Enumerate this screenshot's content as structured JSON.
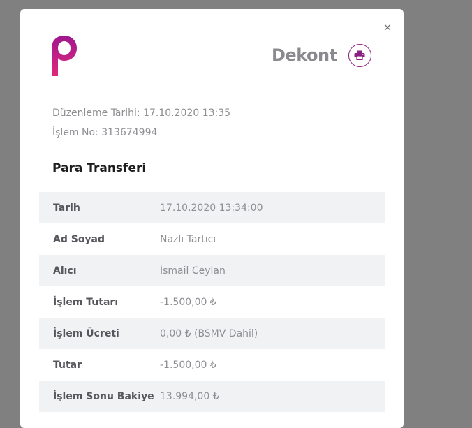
{
  "modal": {
    "title": "Dekont",
    "close_label": "×",
    "icons": {
      "print": "print-icon",
      "logo": "papara-logo",
      "close": "close-icon"
    },
    "accent_color": "#8c1f82"
  },
  "meta": {
    "date_line": "Düzenleme Tarihi: 17.10.2020 13:35",
    "transaction_line": "İşlem No: 313674994"
  },
  "section": {
    "title": "Para Transferi"
  },
  "details": [
    {
      "label": "Tarih",
      "value": "17.10.2020 13:34:00"
    },
    {
      "label": "Ad Soyad",
      "value": "Nazlı Tartıcı"
    },
    {
      "label": "Alıcı",
      "value": "İsmail Ceylan"
    },
    {
      "label": "İşlem Tutarı",
      "value": "-1.500,00 ₺"
    },
    {
      "label": "İşlem Ücreti",
      "value": "0,00 ₺ (BSMV Dahil)"
    },
    {
      "label": "Tutar",
      "value": "-1.500,00 ₺"
    },
    {
      "label": "İşlem Sonu Bakiye",
      "value": "13.994,00 ₺"
    }
  ]
}
